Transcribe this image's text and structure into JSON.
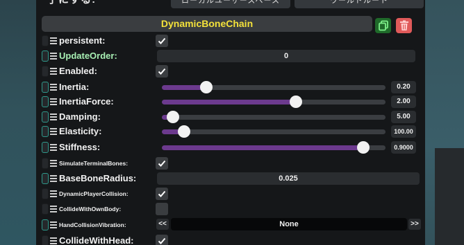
{
  "top": {
    "label": "子にする:",
    "buttons": [
      "ローカルユーザースペース",
      "ワールドルート"
    ]
  },
  "component": {
    "title": "DynamicBoneChain",
    "title_color": "#f4e23a"
  },
  "fields": [
    {
      "label": "persistent:",
      "type": "checkbox",
      "checked": true
    },
    {
      "label": "UpdateOrder:",
      "type": "number",
      "value": "0"
    },
    {
      "label": "Enabled:",
      "type": "checkbox",
      "checked": true
    },
    {
      "label": "Inertia:",
      "type": "slider",
      "value": "0.20",
      "fraction": 0.2
    },
    {
      "label": "InertiaForce:",
      "type": "slider",
      "value": "2.00",
      "fraction": 0.6
    },
    {
      "label": "Damping:",
      "type": "slider",
      "value": "5.00",
      "fraction": 0.05
    },
    {
      "label": "Elasticity:",
      "type": "slider",
      "value": "100.00",
      "fraction": 0.1
    },
    {
      "label": "Stiffness:",
      "type": "slider",
      "value": "0.9000",
      "fraction": 0.9
    },
    {
      "label": "SimulateTerminalBones:",
      "type": "checkbox",
      "checked": true
    },
    {
      "label": "BaseBoneRadius:",
      "type": "number",
      "value": "0.025"
    },
    {
      "label": "DynamicPlayerCollision:",
      "type": "checkbox",
      "checked": true
    },
    {
      "label": "CollideWithOwnBody:",
      "type": "checkbox",
      "checked": false
    },
    {
      "label": "HandCollisionVibration:",
      "type": "enum",
      "value": "None",
      "prev": "<<",
      "next": ">>"
    },
    {
      "label": "CollideWithHead:",
      "type": "checkbox",
      "checked": true
    }
  ],
  "colors": {
    "slider_fill": "#6c3a8e",
    "delete_button": "#e05a5a",
    "duplicate_button": "#1f6a2a"
  }
}
